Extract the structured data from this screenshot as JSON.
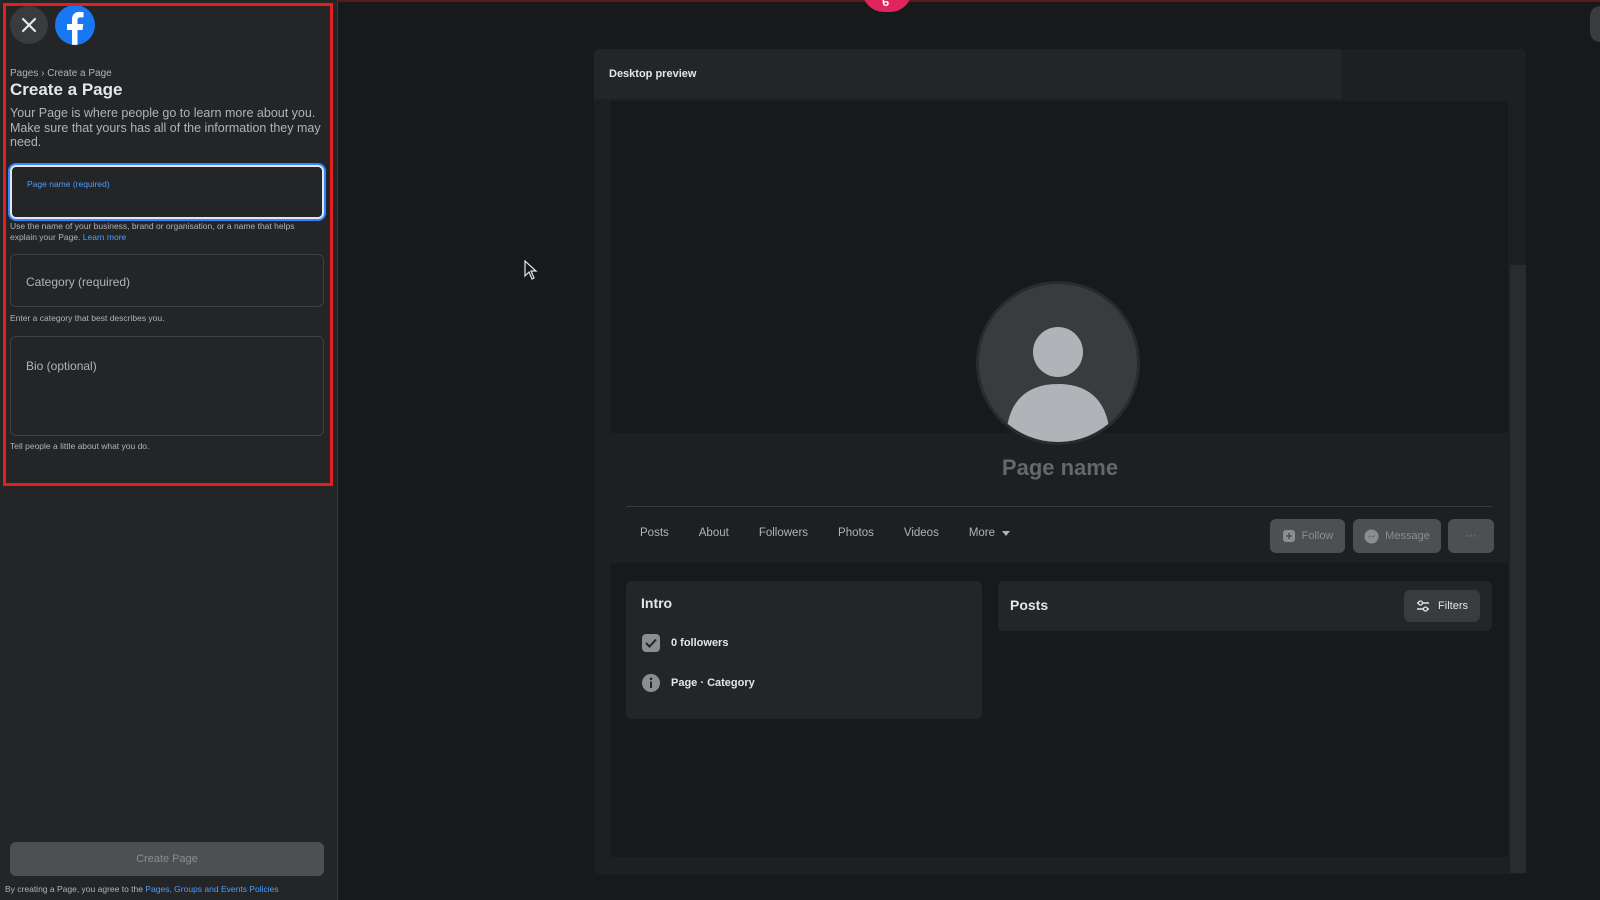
{
  "left_panel": {
    "breadcrumb": "Pages › Create a Page",
    "title": "Create a Page",
    "intro": "Your Page is where people go to learn more about you. Make sure that yours has all of the information they may need.",
    "page_name_label": "Page name (required)",
    "page_name_help": "Use the name of your business, brand or organisation, or a name that helps explain your Page.",
    "learn_more": "Learn more",
    "category_label": "Category (required)",
    "category_help": "Enter a category that best describes you.",
    "bio_label": "Bio (optional)",
    "bio_help": "Tell people a little about what you do.",
    "create_button": "Create Page",
    "terms_prefix": "By creating a Page, you agree to the",
    "terms_link": "Pages, Groups and Events Policies"
  },
  "preview": {
    "header": "Desktop preview",
    "page_name": "Page name",
    "tabs": [
      "Posts",
      "About",
      "Followers",
      "Photos",
      "Videos",
      "More"
    ],
    "follow_button": "Follow",
    "message_button": "Message",
    "more_button": "···",
    "intro_title": "Intro",
    "followers": "0 followers",
    "page_category": "Page · Category",
    "posts_title": "Posts",
    "filters_button": "Filters"
  },
  "colors": {
    "highlight": "#e41e1e",
    "facebook_blue": "#1877f2",
    "link": "#4b9dff",
    "background": "#18191a"
  }
}
